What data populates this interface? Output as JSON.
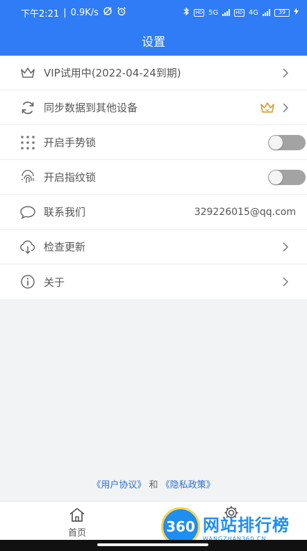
{
  "status_bar": {
    "time": "下午2:21",
    "speed": "0.9K/s",
    "net1": "5G",
    "net2": "4G",
    "battery": "39"
  },
  "header": {
    "title": "设置"
  },
  "settings": [
    {
      "id": "vip",
      "label": "VIP试用中(2022-04-24到期)",
      "icon": "crown-icon"
    },
    {
      "id": "sync",
      "label": "同步数据到其他设备",
      "icon": "sync-icon"
    },
    {
      "id": "gesture",
      "label": "开启手势锁",
      "icon": "dots-grid-icon",
      "toggle": false
    },
    {
      "id": "fingerprint",
      "label": "开启指纹锁",
      "icon": "fingerprint-icon",
      "toggle": false
    },
    {
      "id": "contact",
      "label": "联系我们",
      "icon": "chat-bubble-icon",
      "value": "329226015@qq.com"
    },
    {
      "id": "update",
      "label": "检查更新",
      "icon": "cloud-download-icon"
    },
    {
      "id": "about",
      "label": "关于",
      "icon": "info-icon"
    }
  ],
  "footer": {
    "user_agreement": "《用户协议》",
    "and": "和",
    "privacy": "《隐私政策》"
  },
  "nav": {
    "home": "首页"
  },
  "watermark": {
    "logo": "360",
    "title": "网站排行榜",
    "sub": "WANGZHAN360.CN"
  },
  "colors": {
    "primary": "#2f7cf6",
    "gold": "#d4a23a",
    "toggle_off": "#a3a3a3"
  }
}
